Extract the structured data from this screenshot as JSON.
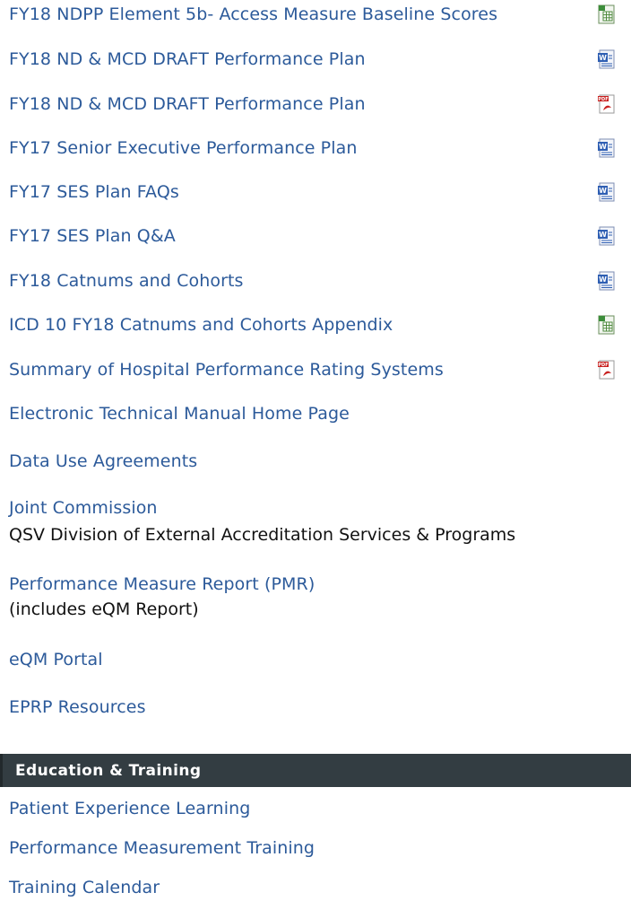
{
  "documents": [
    {
      "label": "FY18 NDPP Element 5b- Access Measure Baseline Scores",
      "icon": "excel-icon"
    },
    {
      "label": "FY18 ND & MCD DRAFT Performance Plan",
      "icon": "word-icon"
    },
    {
      "label": "FY18 ND & MCD DRAFT Performance Plan",
      "icon": "pdf-icon"
    },
    {
      "label": "FY17 Senior Executive Performance Plan",
      "icon": "word-icon"
    },
    {
      "label": "FY17 SES Plan FAQs",
      "icon": "word-icon"
    },
    {
      "label": "FY17 SES Plan Q&A",
      "icon": "word-icon"
    },
    {
      "label": "FY18 Catnums and Cohorts",
      "icon": "word-icon"
    },
    {
      "label": "ICD 10 FY18 Catnums and Cohorts Appendix",
      "icon": "excel-icon"
    },
    {
      "label": "Summary of Hospital Performance Rating Systems",
      "icon": "pdf-icon"
    }
  ],
  "links": {
    "electronic_manual": "Electronic Technical Manual Home Page",
    "data_use": "Data Use Agreements",
    "joint_commission": "Joint Commission",
    "qsv_division": "QSV Division of External Accreditation Services & Programs",
    "pmr": "Performance Measure Report (PMR)",
    "pmr_note": "(includes eQM Report)",
    "eqm_portal": "eQM Portal",
    "eprp": "EPRP Resources"
  },
  "education": {
    "header": "Education & Training",
    "items": [
      "Patient Experience Learning",
      "Performance Measurement Training",
      "Training Calendar"
    ]
  },
  "colors": {
    "link": "#2c5a9a",
    "header_bg": "#333d42",
    "header_text": "#ffffff"
  }
}
